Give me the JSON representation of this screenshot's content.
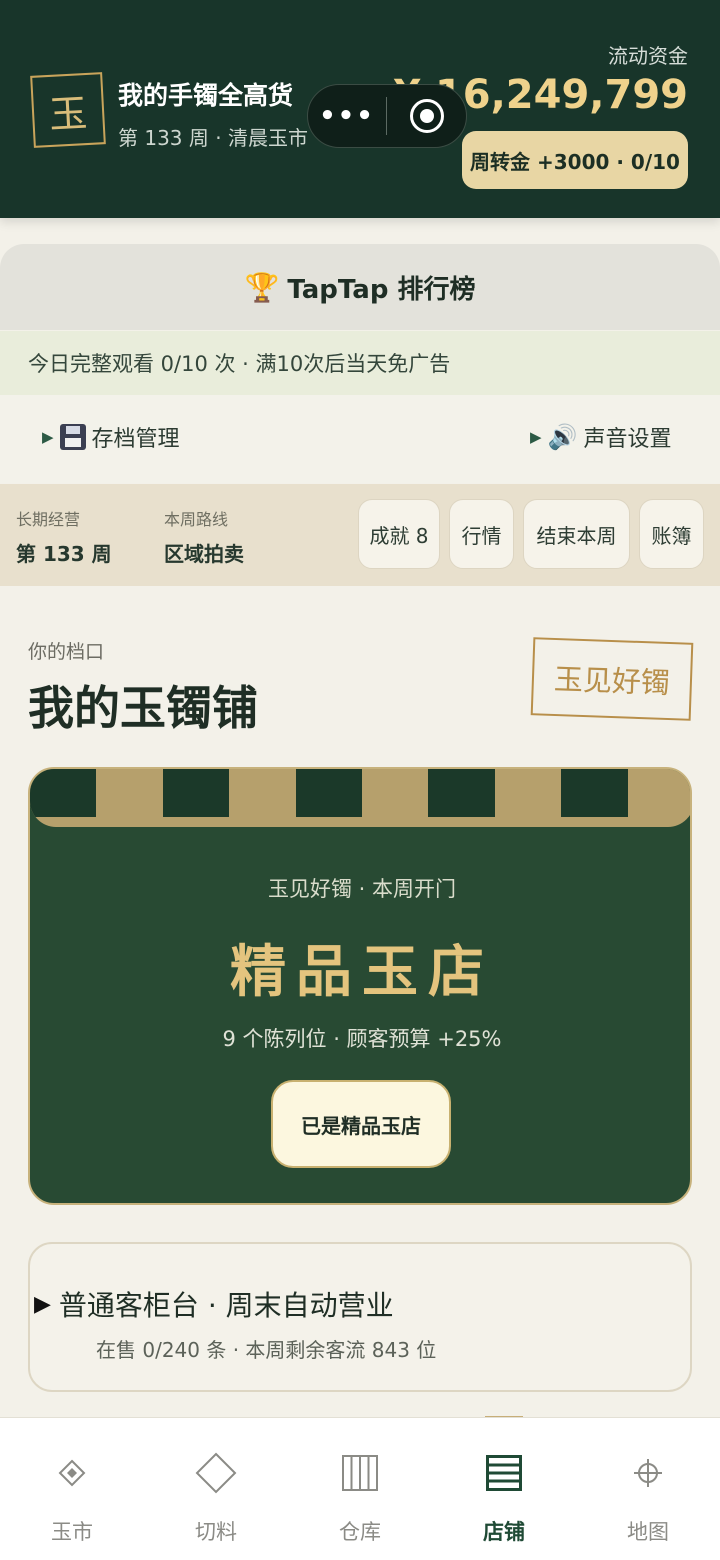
{
  "header": {
    "logo_char": "玉",
    "shop_name": "我的手镯全高货",
    "week_info": "第 133 周 · 清晨玉市",
    "capsule": {
      "more": "•••"
    },
    "funds_label": "流动资金",
    "funds_value": "¥ 16,249,799",
    "weekly_button": "周转金 +3000 · 0/10"
  },
  "leaderboard": {
    "icon": "🏆",
    "label": "TapTap 排行榜"
  },
  "ad_banner": "今日完整观看 0/10 次 · 满10次后当天免广告",
  "settings": {
    "save_label": "存档管理",
    "sound_label": "声音设置"
  },
  "stats": {
    "long_term_label": "长期经营",
    "long_term_value": "第 133 周",
    "route_label": "本周路线",
    "route_value": "区域拍卖",
    "buttons": [
      "成就 8",
      "行情",
      "结束本周",
      "账簿"
    ]
  },
  "stall": {
    "caption": "你的档口",
    "title": "我的玉镯铺",
    "brand_stamp": "玉见好镯"
  },
  "shop_card": {
    "subtitle": "玉见好镯 · 本周开门",
    "title": "精品玉店",
    "description": "9 个陈列位 · 顾客预算 +25%",
    "button": "已是精品玉店"
  },
  "counter": {
    "title": "普通客柜台 · 周末自动营业",
    "subtitle": "在售 0/240 条 · 本周剩余客流 843 位"
  },
  "tabbar": {
    "active": "店铺",
    "tabs": [
      {
        "label": "玉市",
        "icon": "diamond-dot-icon"
      },
      {
        "label": "切料",
        "icon": "diamond-outline-icon"
      },
      {
        "label": "仓库",
        "icon": "columns-icon"
      },
      {
        "label": "店铺",
        "icon": "list-icon"
      },
      {
        "label": "地图",
        "icon": "crosshair-icon"
      }
    ]
  },
  "colors": {
    "header_bg": "#18352a",
    "accent_gold": "#efd28c",
    "card_bg": "#284a33",
    "page_bg": "#f3f1e9"
  }
}
